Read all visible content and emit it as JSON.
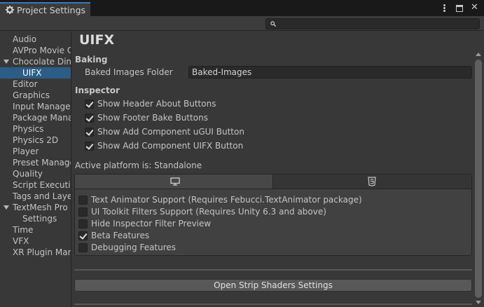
{
  "window": {
    "tab_title": "Project Settings",
    "tab_icon": "gear-icon"
  },
  "search": {
    "placeholder": ""
  },
  "sidebar": {
    "items": [
      {
        "label": "Audio"
      },
      {
        "label": "AVPro Movie C"
      },
      {
        "label": "Chocolate Dine",
        "expanded": true
      },
      {
        "label": "UIFX",
        "selected": true,
        "child": true
      },
      {
        "label": "Editor"
      },
      {
        "label": "Graphics"
      },
      {
        "label": "Input Manager"
      },
      {
        "label": "Package Mana"
      },
      {
        "label": "Physics"
      },
      {
        "label": "Physics 2D"
      },
      {
        "label": "Player"
      },
      {
        "label": "Preset Manage"
      },
      {
        "label": "Quality"
      },
      {
        "label": "Script Executio"
      },
      {
        "label": "Tags and Laye"
      },
      {
        "label": "TextMesh Pro",
        "expanded": true
      },
      {
        "label": "Settings",
        "child": true
      },
      {
        "label": "Time"
      },
      {
        "label": "VFX"
      },
      {
        "label": "XR Plugin Man"
      }
    ]
  },
  "main": {
    "title": "UIFX",
    "baking": {
      "heading": "Baking",
      "baked_images_folder_label": "Baked Images Folder",
      "baked_images_folder_value": "Baked-Images"
    },
    "inspector": {
      "heading": "Inspector",
      "options": [
        {
          "label": "Show Header About Buttons",
          "checked": true
        },
        {
          "label": "Show Footer Bake Buttons",
          "checked": true
        },
        {
          "label": "Show Add Component uGUI Button",
          "checked": true
        },
        {
          "label": "Show Add Component UIFX Button",
          "checked": true
        }
      ]
    },
    "platform": {
      "active_text": "Active platform is: Standalone",
      "tabs": [
        {
          "icon": "monitor-icon",
          "active": true
        },
        {
          "icon": "html5-icon",
          "active": false
        }
      ],
      "options": [
        {
          "label": "Text Animator Support (Requires Febucci.TextAnimator package)",
          "checked": false
        },
        {
          "label": "UI Toolkit Filters Support (Requires Unity 6.3 and above)",
          "checked": false
        },
        {
          "label": "Hide Inspector Filter Preview",
          "checked": false
        },
        {
          "label": "Beta Features",
          "checked": true
        },
        {
          "label": "Debugging Features",
          "checked": false
        }
      ]
    },
    "strip_button_label": "Open Strip Shaders Settings"
  },
  "colors": {
    "accent_selected": "#2c5d87",
    "tab_highlight": "#3a79bb",
    "background": "#383838"
  }
}
